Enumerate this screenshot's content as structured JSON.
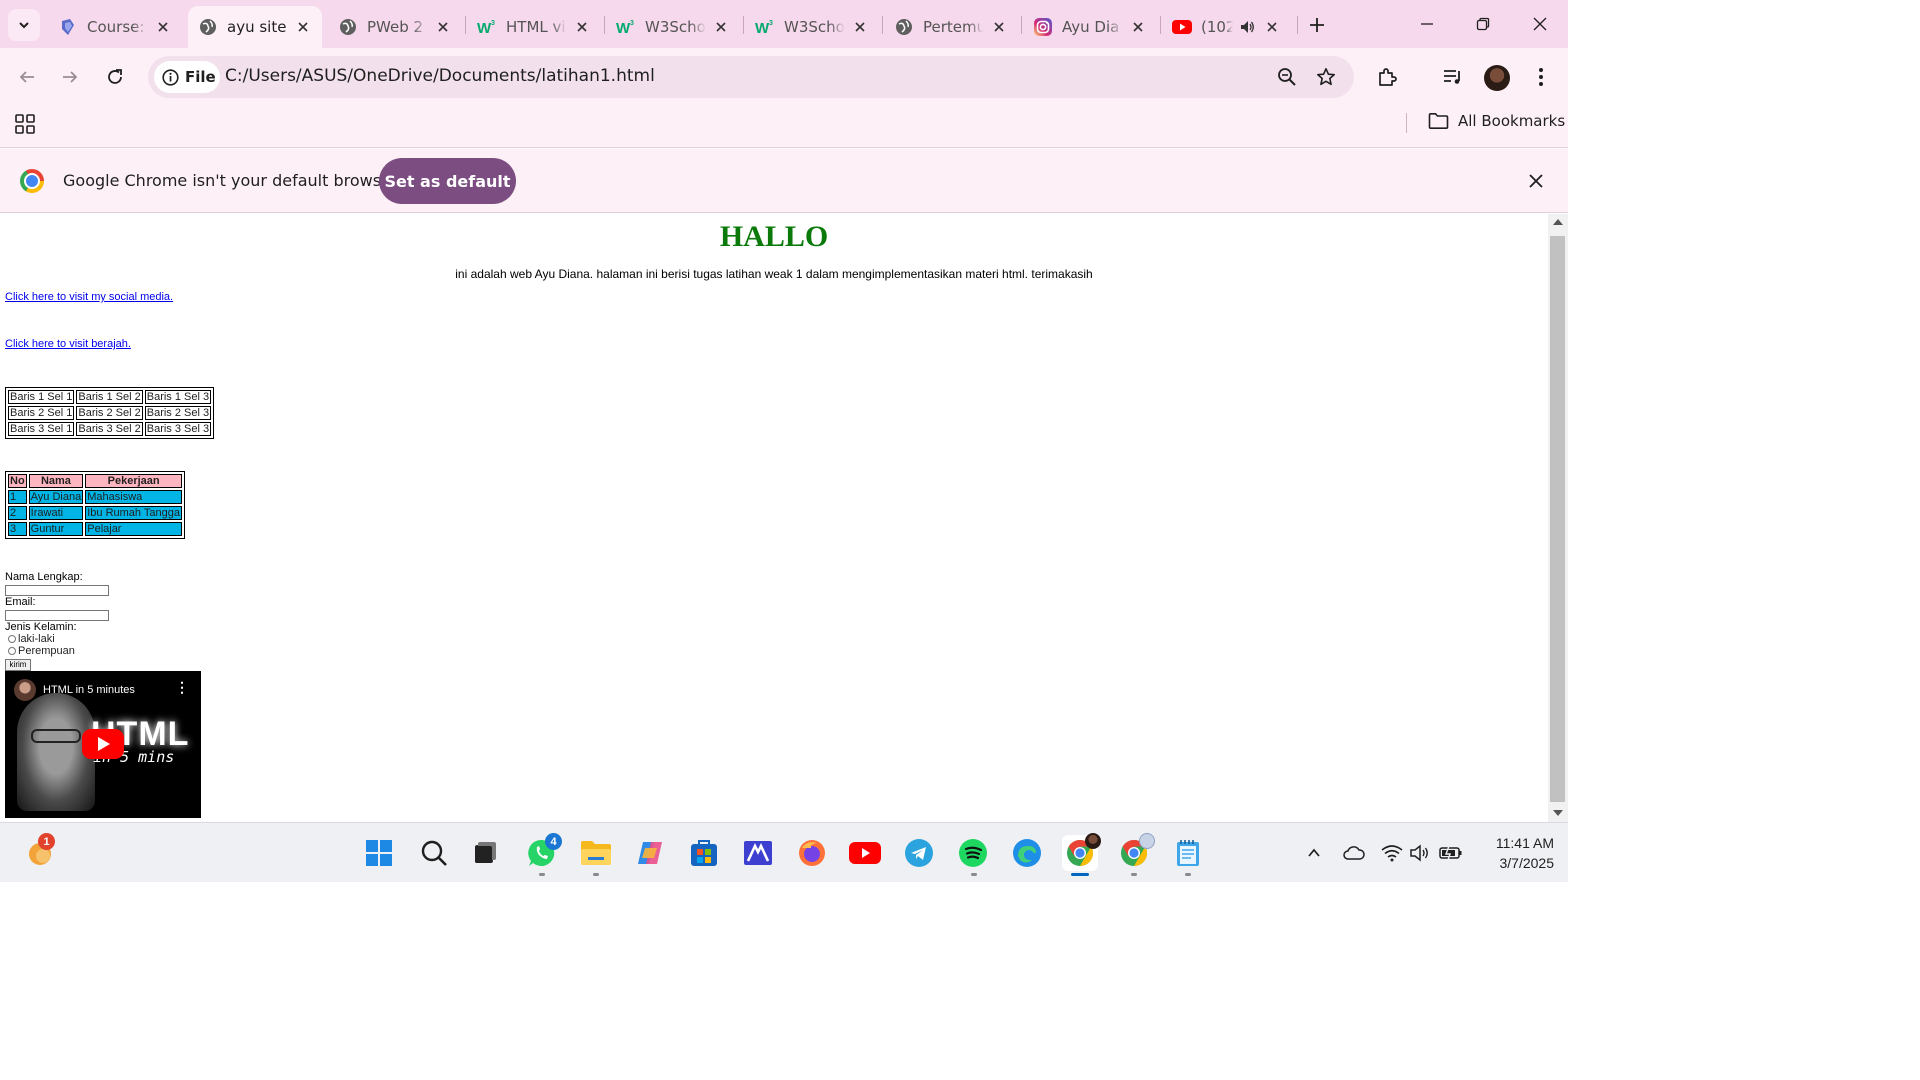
{
  "browser": {
    "tabs": [
      {
        "title": "Course:",
        "favicon": "course-icon"
      },
      {
        "title": "ayu site",
        "favicon": "globe-icon",
        "active": true
      },
      {
        "title": "PWeb 2",
        "favicon": "globe-icon"
      },
      {
        "title": "HTML vi",
        "favicon": "w3schools-icon"
      },
      {
        "title": "W3Scho",
        "favicon": "w3schools-icon"
      },
      {
        "title": "W3Scho",
        "favicon": "w3schools-icon"
      },
      {
        "title": "Pertemu",
        "favicon": "globe-icon"
      },
      {
        "title": "Ayu Dia",
        "favicon": "instagram-icon"
      },
      {
        "title": "(102",
        "favicon": "youtube-icon",
        "audio": true
      }
    ],
    "omnibox": {
      "chip_label": "File",
      "url": "C:/Users/ASUS/OneDrive/Documents/latihan1.html"
    },
    "bookmarks": {
      "all_label": "All Bookmarks"
    },
    "infobar": {
      "message": "Google Chrome isn't your default browser",
      "button_label": "Set as default"
    },
    "colors": {
      "tabstrip": "#f6d9ec",
      "toolbar": "#fdf0f7",
      "accent_button": "#7b4d80"
    }
  },
  "page": {
    "title": "HALLO",
    "subtitle": "ini adalah web Ayu Diana. halaman ini berisi tugas latihan weak 1 dalam mengimplementasikan materi html. terimakasih",
    "links": [
      {
        "text": "Click here to visit my social media."
      },
      {
        "text": "Click here to visit berajah."
      }
    ],
    "table1": {
      "rows": [
        [
          "Baris 1 Sel 1",
          "Baris 1 Sel 2",
          "Baris 1 Sel 3"
        ],
        [
          "Baris 2 Sel 1",
          "Baris 2 Sel 2",
          "Baris 2 Sel 3"
        ],
        [
          "Baris 3 Sel 1",
          "Baris 3 Sel 2",
          "Baris 3 Sel 3"
        ]
      ]
    },
    "table2": {
      "headers": [
        "No",
        "Nama",
        "Pekerjaan"
      ],
      "rows": [
        [
          "1",
          "Ayu Diana",
          "Mahasiswa"
        ],
        [
          "2",
          "Irawati",
          "Ibu Rumah Tangga"
        ],
        [
          "3",
          "Guntur",
          "Pelajar"
        ]
      ],
      "header_color": "#ffb6c1",
      "cell_color": "#00b4e6"
    },
    "form": {
      "name_label": "Nama Lengkap:",
      "name_value": "",
      "email_label": "Email:",
      "email_value": "",
      "gender_label": "Jenis Kelamin:",
      "gender_options": [
        "laki-laki",
        "Perempuan"
      ],
      "submit_label": "kirim"
    },
    "video": {
      "title": "HTML in 5 minutes",
      "thumb_big": "HTML",
      "thumb_small": "in 5 mins"
    },
    "title_color": "#0b7a0b"
  },
  "taskbar": {
    "weather_badge": "1",
    "whatsapp_badge": "4",
    "apps": [
      "weather-icon",
      "start-icon",
      "search-icon",
      "task-view-icon",
      "whatsapp-icon",
      "file-explorer-icon",
      "copilot-icon",
      "microsoft-store-icon",
      "mail-icon",
      "firefox-icon",
      "youtube-icon",
      "telegram-icon",
      "spotify-icon",
      "edge-icon",
      "chrome-icon",
      "chrome-profile-icon",
      "notepad-icon"
    ],
    "clock": {
      "time": "11:41 AM",
      "date": "3/7/2025"
    }
  }
}
